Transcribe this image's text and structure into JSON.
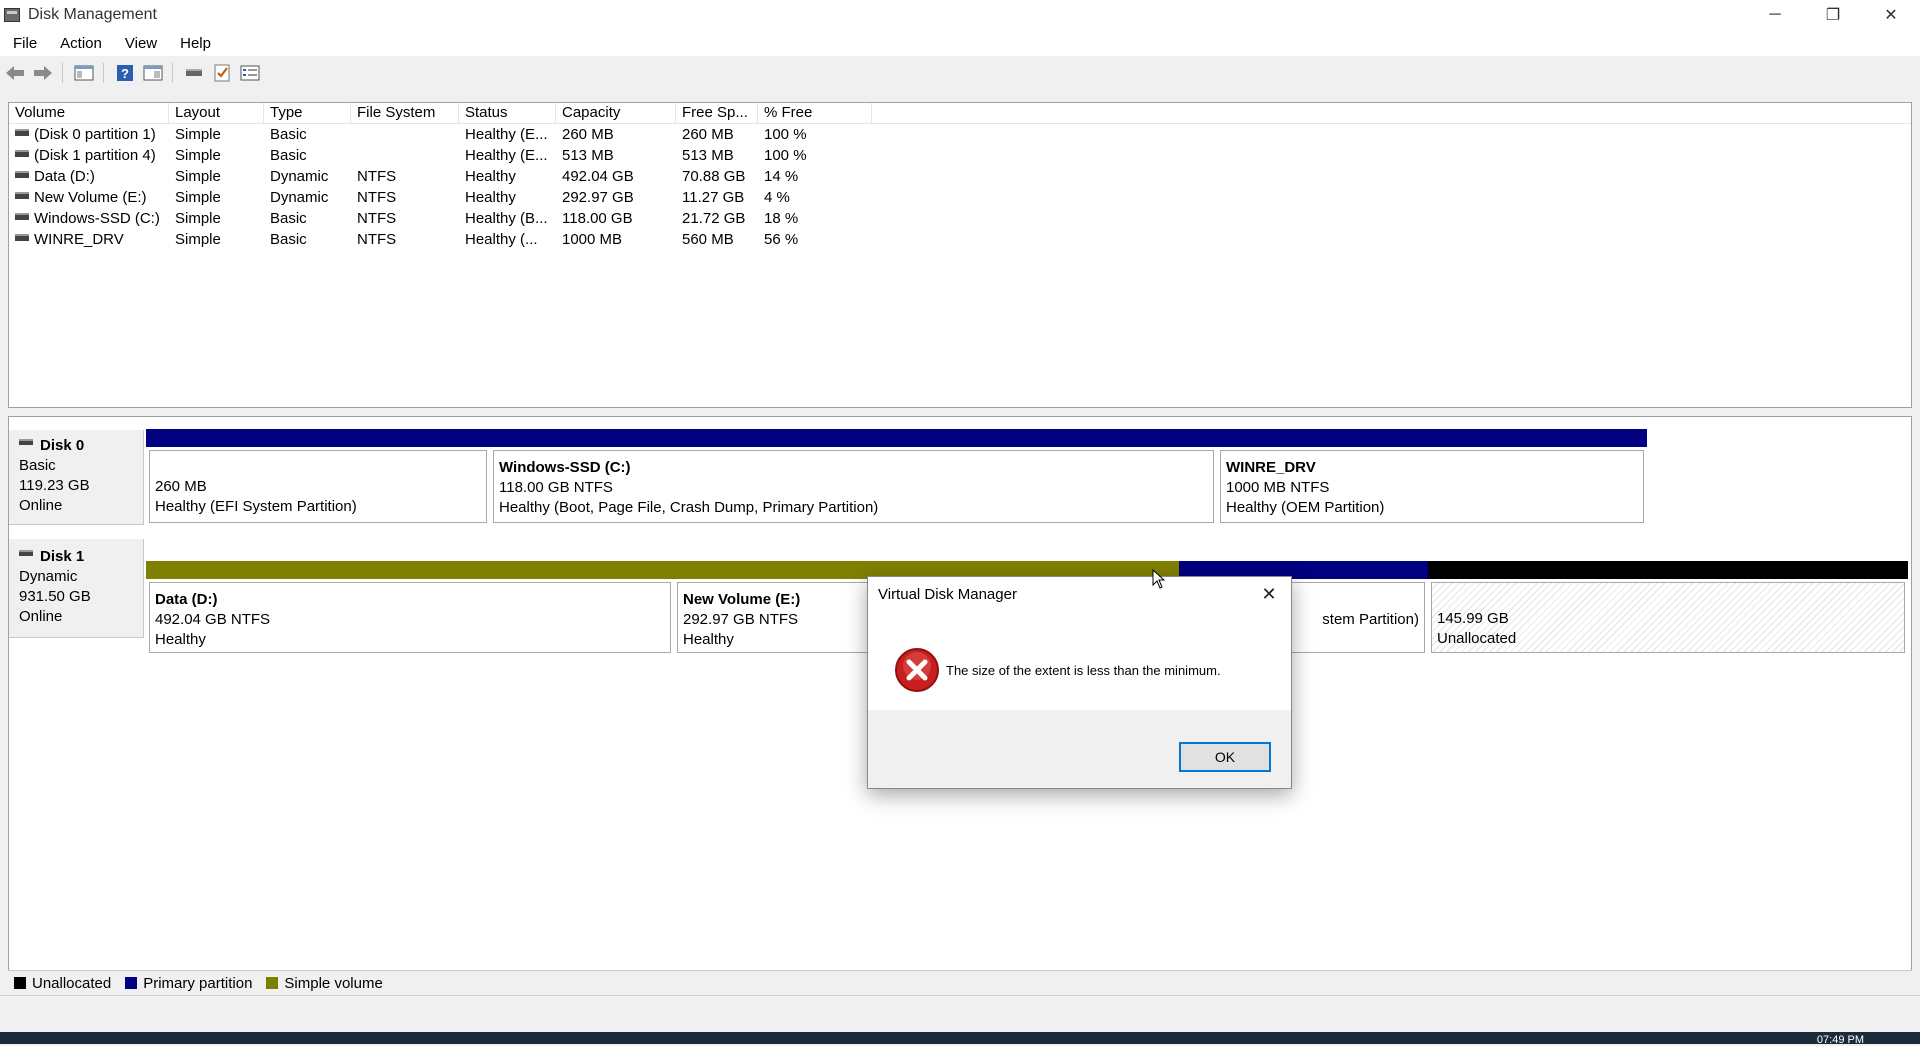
{
  "window": {
    "title": "Disk Management",
    "controls": {
      "minimize": "─",
      "restore": "❐",
      "close": "✕"
    }
  },
  "menu": [
    "File",
    "Action",
    "View",
    "Help"
  ],
  "toolbar": {
    "icons": [
      "back-arrow-icon",
      "forward-arrow-icon",
      "console-tree-icon",
      "help-icon",
      "properties-icon",
      "connect-icon",
      "check-icon",
      "settings-list-icon"
    ]
  },
  "volume_list": {
    "columns": [
      "Volume",
      "Layout",
      "Type",
      "File System",
      "Status",
      "Capacity",
      "Free Sp...",
      "% Free"
    ],
    "rows": [
      [
        "(Disk 0 partition 1)",
        "Simple",
        "Basic",
        "",
        "Healthy (E...",
        "260 MB",
        "260 MB",
        "100 %"
      ],
      [
        "(Disk 1 partition 4)",
        "Simple",
        "Basic",
        "",
        "Healthy (E...",
        "513 MB",
        "513 MB",
        "100 %"
      ],
      [
        "Data (D:)",
        "Simple",
        "Dynamic",
        "NTFS",
        "Healthy",
        "492.04 GB",
        "70.88 GB",
        "14 %"
      ],
      [
        "New Volume (E:)",
        "Simple",
        "Dynamic",
        "NTFS",
        "Healthy",
        "292.97 GB",
        "11.27 GB",
        "4 %"
      ],
      [
        "Windows-SSD (C:)",
        "Simple",
        "Basic",
        "NTFS",
        "Healthy (B...",
        "118.00 GB",
        "21.72 GB",
        "18 %"
      ],
      [
        "WINRE_DRV",
        "Simple",
        "Basic",
        "NTFS",
        "Healthy (...",
        "1000 MB",
        "560 MB",
        "56 %"
      ]
    ]
  },
  "disks": [
    {
      "name": "Disk 0",
      "type": "Basic",
      "size": "119.23 GB",
      "state": "Online",
      "partitions": [
        {
          "name": "",
          "size": "260 MB",
          "status": "Healthy (EFI System Partition)",
          "color": "#000080"
        },
        {
          "name": "Windows-SSD  (C:)",
          "size": "118.00 GB NTFS",
          "status": "Healthy (Boot, Page File, Crash Dump, Primary Partition)",
          "color": "#000080"
        },
        {
          "name": "WINRE_DRV",
          "size": "1000 MB NTFS",
          "status": "Healthy (OEM Partition)",
          "color": "#000080"
        }
      ]
    },
    {
      "name": "Disk 1",
      "type": "Dynamic",
      "size": "931.50 GB",
      "state": "Online",
      "partitions": [
        {
          "name": "Data  (D:)",
          "size": "492.04 GB NTFS",
          "status": "Healthy",
          "color": "#808000"
        },
        {
          "name": "New Volume  (E:)",
          "size": "292.97 GB NTFS",
          "status": "Healthy",
          "color": "#808000"
        },
        {
          "name": "",
          "size": "",
          "status": "stem Partition)",
          "color": "#000080"
        },
        {
          "name": "",
          "size": "145.99 GB",
          "status": "Unallocated",
          "color": "#000000"
        }
      ]
    }
  ],
  "legend": [
    {
      "label": "Unallocated",
      "color": "#000000"
    },
    {
      "label": "Primary partition",
      "color": "#000080"
    },
    {
      "label": "Simple volume",
      "color": "#808000"
    }
  ],
  "dialog": {
    "title": "Virtual Disk Manager",
    "message": "The size of the extent is less than the minimum.",
    "ok_label": "OK",
    "close": "✕"
  },
  "taskbar": {
    "clock": "07:49 PM"
  }
}
